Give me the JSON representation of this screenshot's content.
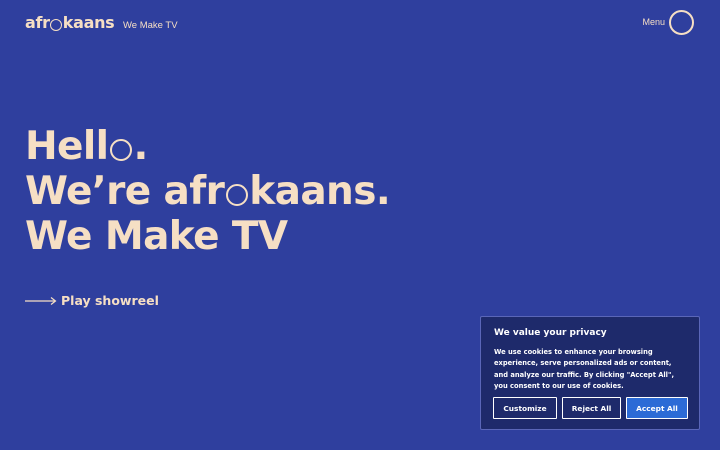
{
  "header": {
    "logo": {
      "part1": "afr",
      "part2": "kaans"
    },
    "tagline": "We Make TV",
    "menu_label": "Menu"
  },
  "hero": {
    "line1": {
      "before": "Hell",
      "after": "."
    },
    "line2": {
      "before": "We’re afr",
      "after": "kaans."
    },
    "line3": "We Make TV"
  },
  "showreel": {
    "label": "Play showreel",
    "icon": "long-arrow-right-icon"
  },
  "cookie_banner": {
    "title": "We value your privacy",
    "text": "We use cookies to enhance your browsing experience, serve personalized ads or content, and analyze our traffic. By clicking \"Accept All\", you consent to our use of cookies.",
    "buttons": {
      "customize": "Customize",
      "reject": "Reject All",
      "accept": "Accept All"
    }
  },
  "colors": {
    "background": "#2f3f9e",
    "text": "#f6dfc4",
    "cookie_panel": "#1e2a6b",
    "accept_button": "#2c6bd6"
  }
}
